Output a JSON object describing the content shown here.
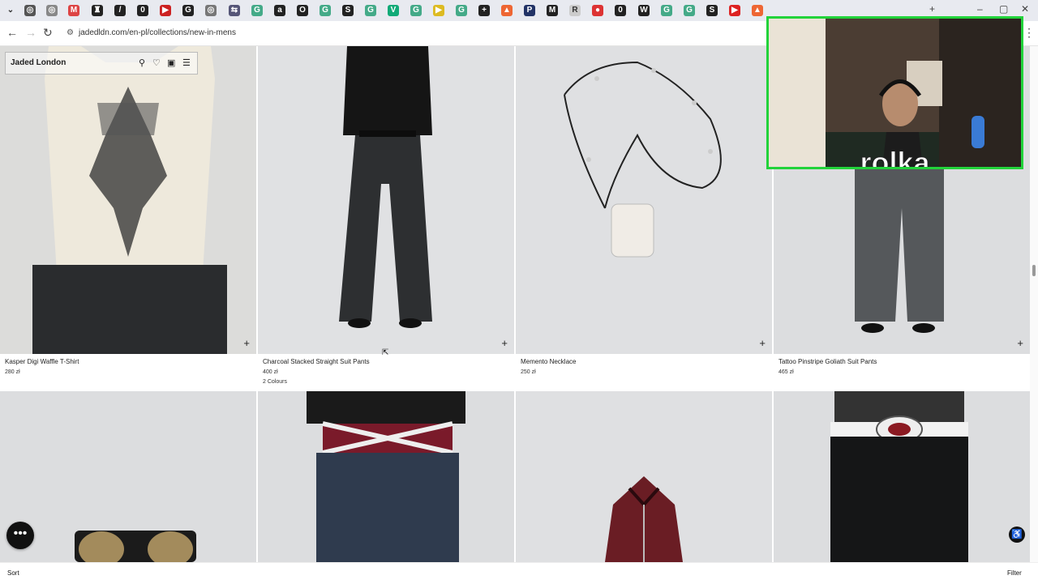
{
  "browser": {
    "url": "jadedldn.com/en-pl/collections/new-in-mens",
    "new_tab": "+",
    "close_tab": "×"
  },
  "header": {
    "brand": "Jaded London"
  },
  "products_row1": [
    {
      "name": "Kasper Digi Waffle T-Shirt",
      "price": "280 zł",
      "colours": ""
    },
    {
      "name": "Charcoal Stacked Straight Suit Pants",
      "price": "400 zł",
      "colours": "2 Colours"
    },
    {
      "name": "Memento Necklace",
      "price": "250 zł",
      "colours": ""
    },
    {
      "name": "Tattoo Pinstripe Goliath Suit Pants",
      "price": "465 zł",
      "colours": ""
    }
  ],
  "webcam": {
    "caption": "rolka"
  },
  "footer": {
    "sort_label": "Sort",
    "filter_label": "Filter"
  }
}
